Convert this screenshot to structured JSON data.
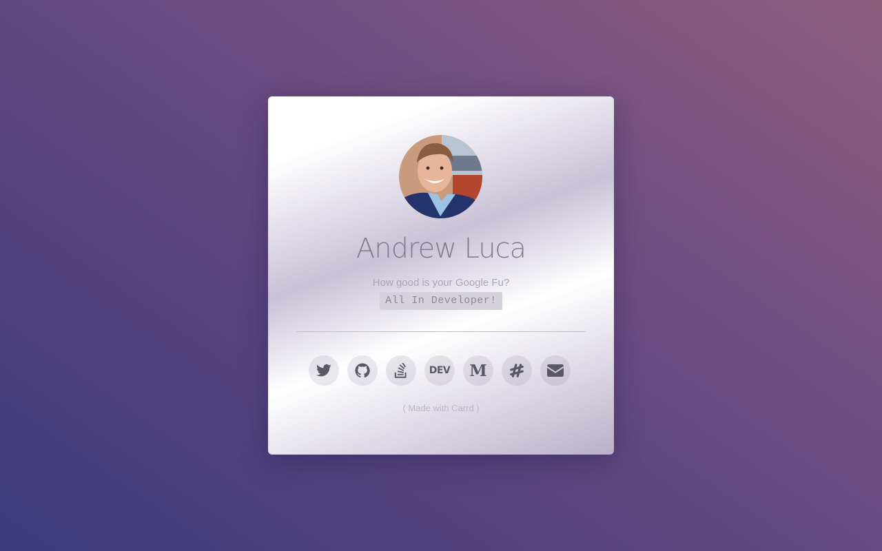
{
  "profile": {
    "name": "Andrew Luca",
    "tagline": "How good is your Google Fu?",
    "code_badge": "All In Developer!"
  },
  "social_links": [
    {
      "name": "Twitter",
      "icon": "twitter-icon"
    },
    {
      "name": "GitHub",
      "icon": "github-icon"
    },
    {
      "name": "Stack Overflow",
      "icon": "stackoverflow-icon"
    },
    {
      "name": "DEV",
      "icon": "dev-icon",
      "label": "DEV"
    },
    {
      "name": "Medium",
      "icon": "medium-icon",
      "label": "M"
    },
    {
      "name": "Slack",
      "icon": "slack-icon"
    },
    {
      "name": "Email",
      "icon": "envelope-icon"
    }
  ],
  "footer": {
    "made_with": "( Made with Carrd )"
  },
  "colors": {
    "background_start": "#3d3a7a",
    "background_end": "#8c5e7e",
    "card": "#ffffff",
    "icon": "#5b5866"
  }
}
